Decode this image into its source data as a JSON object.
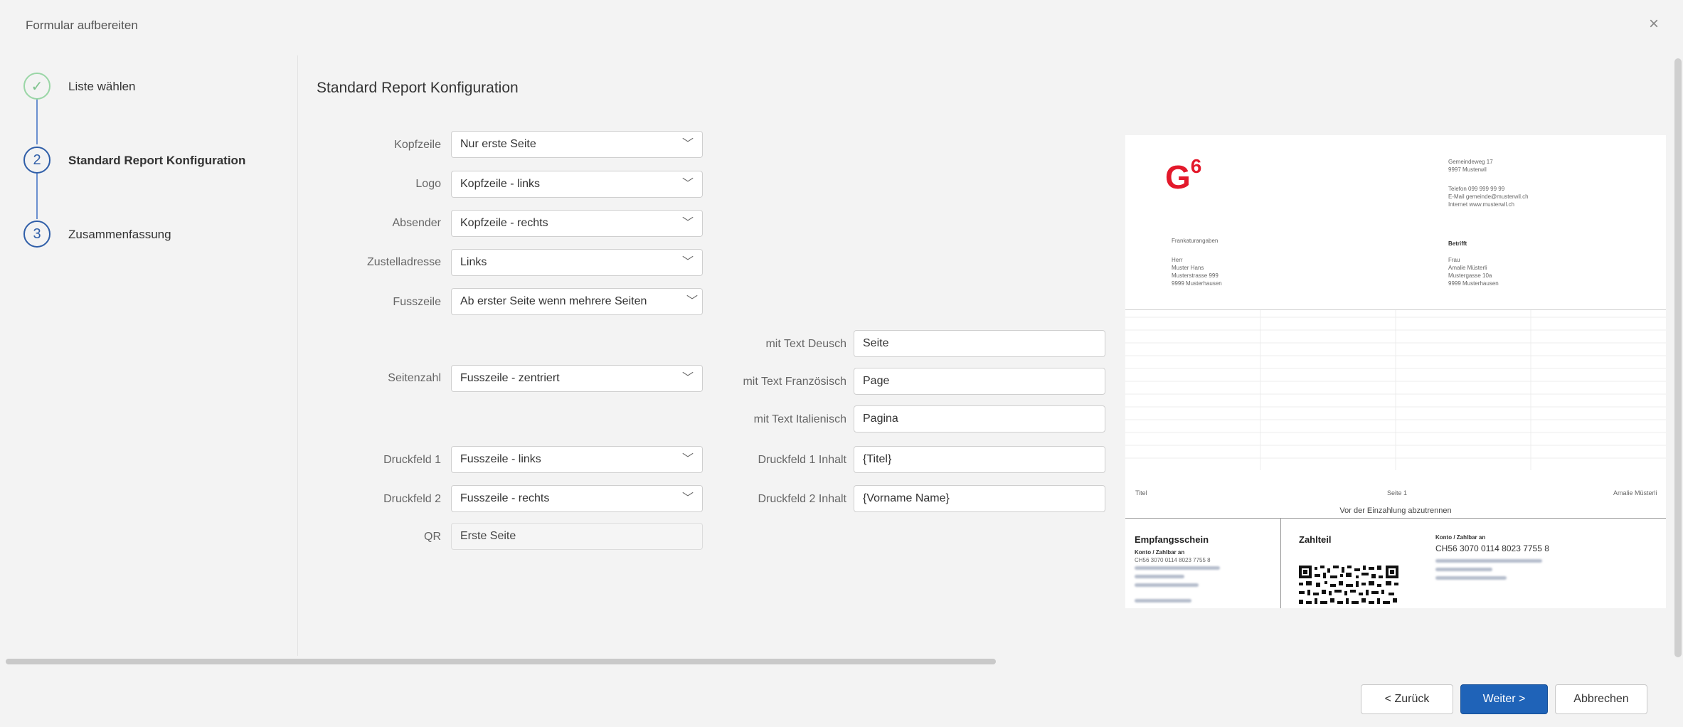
{
  "window": {
    "title": "Formular aufbereiten",
    "close": "×"
  },
  "steps": [
    {
      "number": "✓",
      "label": "Liste wählen",
      "state": "done"
    },
    {
      "number": "2",
      "label": "Standard Report Konfiguration",
      "state": "active"
    },
    {
      "number": "3",
      "label": "Zusammenfassung",
      "state": "todo"
    }
  ],
  "form": {
    "title": "Standard Report Konfiguration",
    "kopfzeile": {
      "label": "Kopfzeile",
      "value": "Nur erste Seite"
    },
    "logo": {
      "label": "Logo",
      "value": "Kopfzeile - links"
    },
    "absender": {
      "label": "Absender",
      "value": "Kopfzeile - rechts"
    },
    "zustelladresse": {
      "label": "Zustelladresse",
      "value": "Links"
    },
    "fusszeile": {
      "label": "Fusszeile",
      "value": "Ab erster Seite wenn mehrere Seiten"
    },
    "seitenzahl": {
      "label": "Seitenzahl",
      "value": "Fusszeile - zentriert"
    },
    "text_de": {
      "label": "mit Text Deusch",
      "value": "Seite"
    },
    "text_fr": {
      "label": "mit Text Französisch",
      "value": "Page"
    },
    "text_it": {
      "label": "mit Text Italienisch",
      "value": "Pagina"
    },
    "druckfeld1": {
      "label": "Druckfeld 1",
      "value": "Fusszeile - links"
    },
    "druckfeld1_inhalt": {
      "label": "Druckfeld 1 Inhalt",
      "value": "{Titel}"
    },
    "druckfeld2": {
      "label": "Druckfeld 2",
      "value": "Fusszeile - rechts"
    },
    "druckfeld2_inhalt": {
      "label": "Druckfeld 2 Inhalt",
      "value": "{Vorname Name}"
    },
    "qr": {
      "label": "QR",
      "value": "Erste Seite"
    }
  },
  "preview": {
    "logo_text": "G",
    "logo_sup": "6",
    "sender_lines": [
      "Gemeindeweg 17",
      "9997 Musterwil"
    ],
    "contact_lines": [
      "Telefon  099 999 99 99",
      "E-Mail   gemeinde@musterwil.ch",
      "Internet www.musterwil.ch"
    ],
    "left_block_title": "Frankaturangaben",
    "left_address": [
      "Herr",
      "Muster Hans",
      "Musterstrasse 999",
      "9999 Musterhausen"
    ],
    "right_block_title": "Betrifft",
    "right_address": [
      "Frau",
      "Amalie Müsterli",
      "Mustergasse 10a",
      "9999 Musterhausen"
    ],
    "footer_left": "Titel",
    "footer_center": "Seite 1",
    "footer_right": "Amalie Müsterli",
    "cut_text": "Vor der Einzahlung abzutrennen",
    "receipt_title": "Empfangsschein",
    "receipt_konto": "Konto / Zahlbar an",
    "receipt_iban": "CH56 3070 0114 8023 7755 8",
    "payment_title": "Zahlteil",
    "payment_konto": "Konto / Zahlbar an",
    "payment_iban": "CH56 3070 0114 8023 7755 8",
    "brand_color": "#e3192b"
  },
  "buttons": {
    "back": "< Zurück",
    "next": "Weiter >",
    "cancel": "Abbrechen"
  },
  "colors": {
    "primary": "#1f63b8",
    "step_active": "#2f5ea8",
    "step_done": "#7cc28b"
  }
}
